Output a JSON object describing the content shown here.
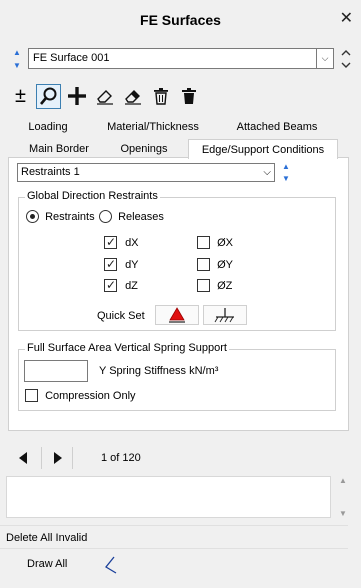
{
  "window": {
    "title": "FE Surfaces",
    "close_glyph": "✕"
  },
  "surface_selector": {
    "value": "FE Surface 001",
    "dropdown_glyph": "⌵"
  },
  "toolbar": {
    "buttons": [
      {
        "name": "plus-minus-icon",
        "glyph": "±"
      },
      {
        "name": "search-icon",
        "active": true
      },
      {
        "name": "add-icon"
      },
      {
        "name": "eraser-outline-icon"
      },
      {
        "name": "eraser-filled-icon"
      },
      {
        "name": "delete-outline-icon"
      },
      {
        "name": "delete-filled-icon"
      }
    ]
  },
  "tabs": {
    "row1": [
      "Loading",
      "Material/Thickness",
      "Attached Beams"
    ],
    "row2": [
      "Main Border",
      "Openings",
      "Edge/Support Conditions"
    ],
    "selected": "Edge/Support Conditions"
  },
  "restraint_selector": {
    "value": "Restraints 1"
  },
  "global_direction": {
    "legend": "Global Direction Restraints",
    "mode_options": [
      "Restraints",
      "Releases"
    ],
    "mode_selected": "Restraints",
    "translations": [
      {
        "label": "dX",
        "checked": true
      },
      {
        "label": "dY",
        "checked": true
      },
      {
        "label": "dZ",
        "checked": true
      }
    ],
    "rotations": [
      {
        "label": "ØX",
        "checked": false
      },
      {
        "label": "ØY",
        "checked": false
      },
      {
        "label": "ØZ",
        "checked": false
      }
    ],
    "quick_set_label": "Quick Set"
  },
  "spring_support": {
    "legend": "Full Surface Area Vertical Spring Support",
    "stiffness_value": "",
    "stiffness_label": "Y Spring Stiffness kN/m³",
    "compression_only_label": "Compression Only",
    "compression_only_checked": false
  },
  "pager": {
    "text": "1 of 120"
  },
  "notes": {
    "value": ""
  },
  "actions": {
    "delete_all_invalid": "Delete All Invalid",
    "draw_all": "Draw All"
  },
  "colors": {
    "accent": "#2a6fd6",
    "pin_red": "#e01010",
    "panel_bg": "#ffffff",
    "window_bg": "#f0f0f0"
  }
}
